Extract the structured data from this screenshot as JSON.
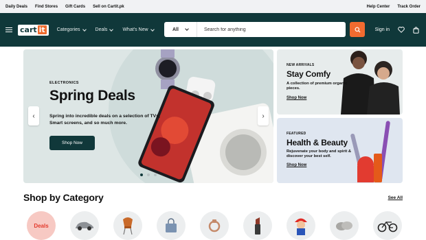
{
  "topbar": {
    "left_links": [
      "Daily Deals",
      "Find Stores",
      "Gift Cards",
      "Sell on Cartit.pk"
    ],
    "right_links": [
      "Help Center",
      "Track Order"
    ]
  },
  "header": {
    "logo_cart": "cart",
    "logo_it": "it",
    "nav": [
      "Categories",
      "Deals",
      "What's New"
    ],
    "search_category": "All",
    "search_placeholder": "Search for anything",
    "signin": "Sign in"
  },
  "hero": {
    "tag": "ELECTRONICS",
    "title": "Spring Deals",
    "description": "Spring into incredible deals on a selection of TVs, Smart screens, and so much more.",
    "cta": "Shop Now",
    "slide_count": 3,
    "active_slide": 1
  },
  "promos": [
    {
      "tag": "NEW ARRIVALS",
      "title": "Stay Comfy",
      "description": "A collection of premium organic pieces.",
      "link": "Shop Now"
    },
    {
      "tag": "FEATURED",
      "title": "Health & Beauty",
      "description": "Rejuvenate your body and spirit & discover your best self.",
      "link": "Shop Now"
    }
  ],
  "categories": {
    "title": "Shop by Category",
    "see_all": "See All",
    "deals_label": "Deals",
    "items": [
      "deals",
      "car",
      "chair",
      "handbag",
      "ring",
      "lipstick",
      "mario-figure",
      "slippers",
      "bicycle"
    ]
  },
  "colors": {
    "header_bg": "#10383a",
    "accent": "#f26b30",
    "promo1_bg": "#e7ecec",
    "promo2_bg": "#dfe6f0"
  }
}
